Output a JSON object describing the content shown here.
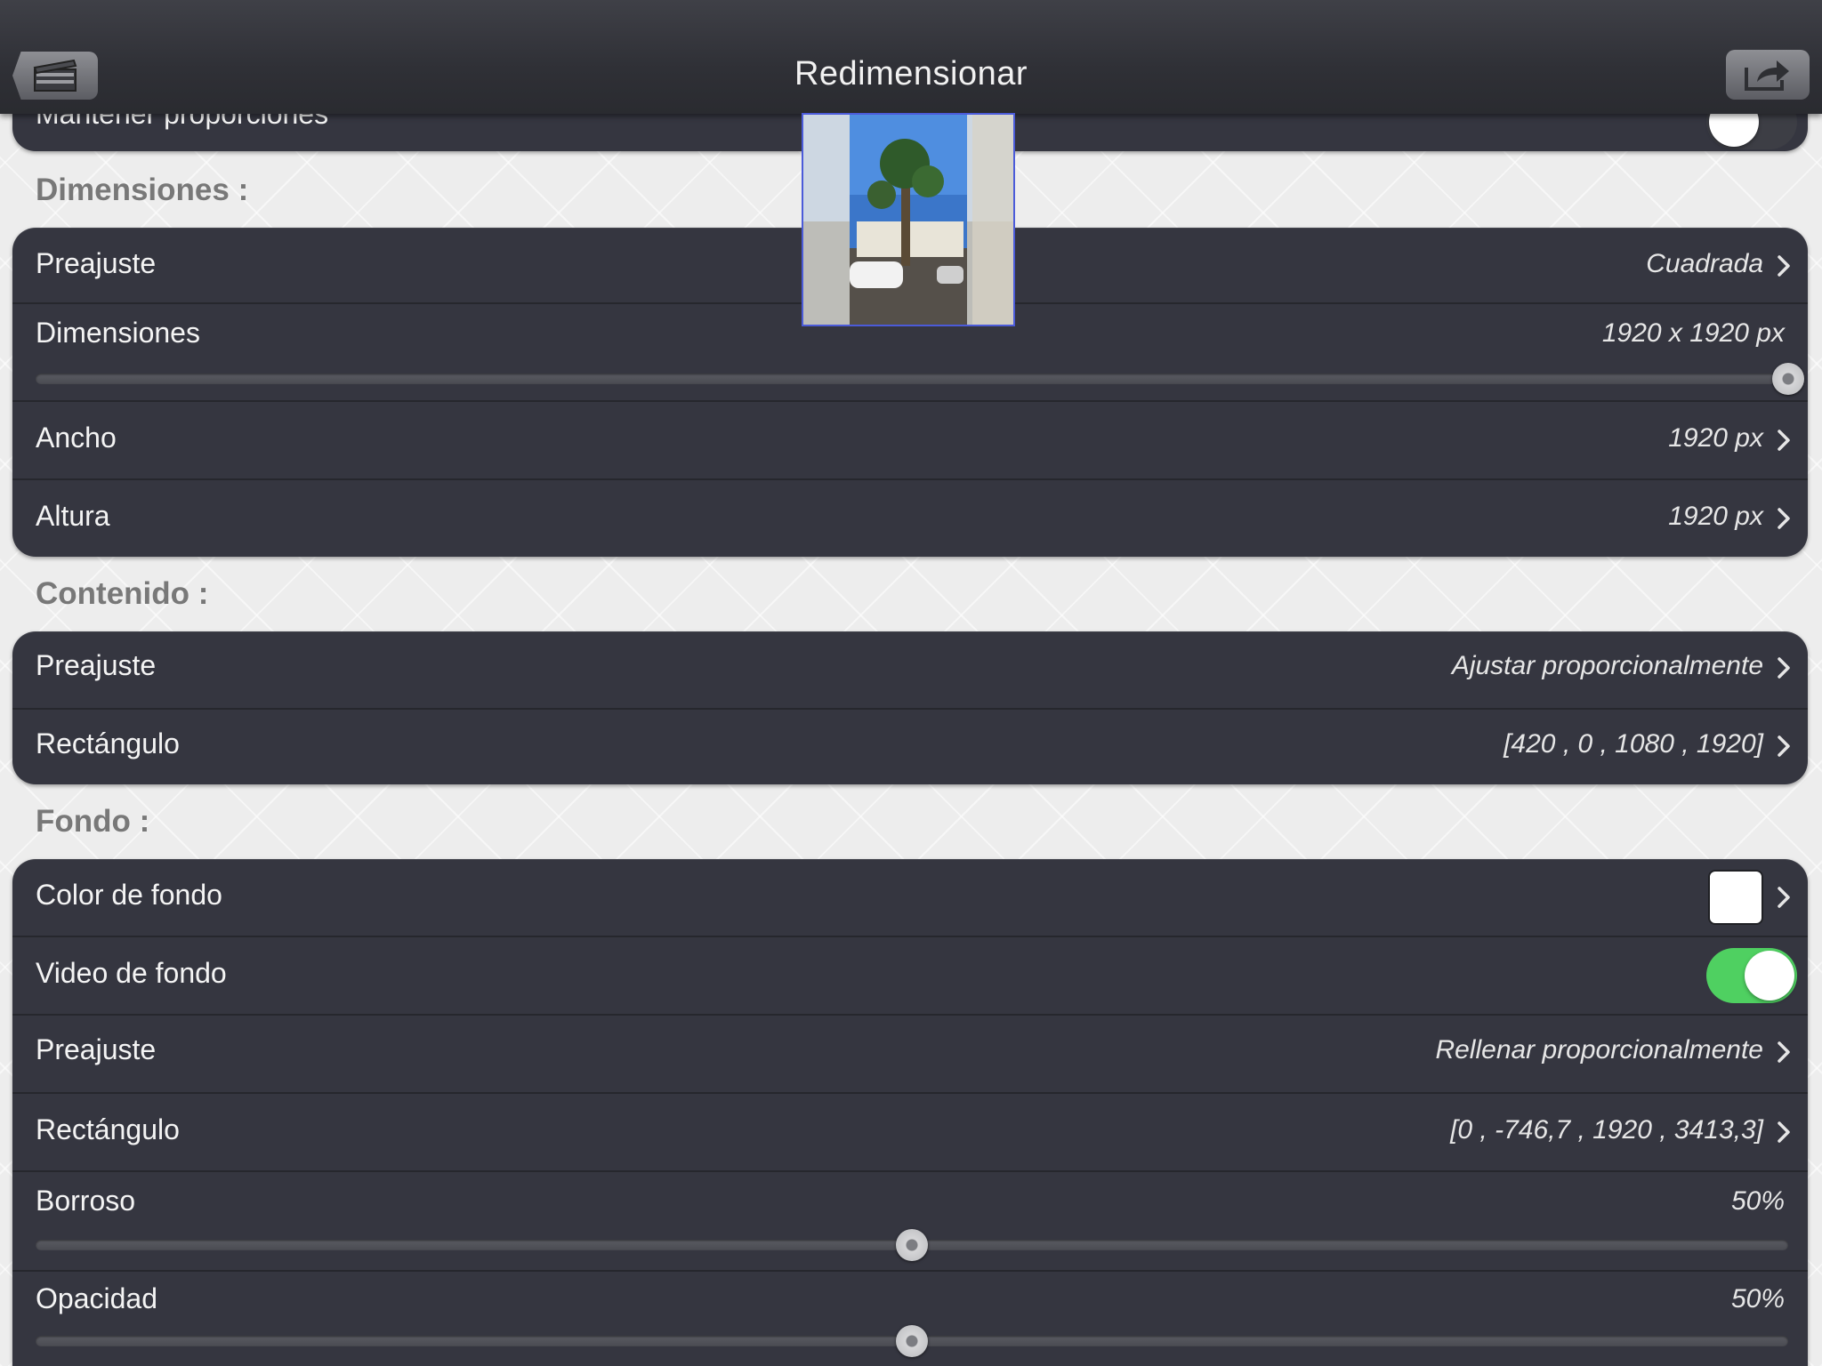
{
  "nav": {
    "title": "Redimensionar",
    "back_icon": "clapperboard-icon",
    "share_icon": "share-icon"
  },
  "top_partial": {
    "label": "Mantener proporciones",
    "switch_on": false
  },
  "sections": {
    "dimensiones": "Dimensiones :",
    "contenido": "Contenido :",
    "fondo": "Fondo :"
  },
  "dimensiones": {
    "preajuste_label": "Preajuste",
    "preajuste_value": "Cuadrada",
    "dimensiones_label": "Dimensiones",
    "dimensiones_value": "1920 x 1920 px",
    "dimensiones_slider_level": 1.0,
    "ancho_label": "Ancho",
    "ancho_value": "1920 px",
    "altura_label": "Altura",
    "altura_value": "1920 px"
  },
  "contenido": {
    "preajuste_label": "Preajuste",
    "preajuste_value": "Ajustar proporcionalmente",
    "rect_label": "Rectángulo",
    "rect_value": "[420 , 0 , 1080 , 1920]"
  },
  "fondo": {
    "color_label": "Color de fondo",
    "color_value": "#ffffff",
    "video_label": "Video de fondo",
    "video_on": true,
    "preajuste_label": "Preajuste",
    "preajuste_value": "Rellenar proporcionalmente",
    "rect_label": "Rectángulo",
    "rect_value": "[0 , -746,7 , 1920 , 3413,3]",
    "borroso_label": "Borroso",
    "borroso_value": "50%",
    "borroso_level": 0.5,
    "opacidad_label": "Opacidad",
    "opacidad_value": "50%",
    "opacidad_level": 0.5
  },
  "colors": {
    "accent_green": "#4fd061",
    "card_bg": "#353640",
    "navbar_bg": "#2f3036"
  }
}
